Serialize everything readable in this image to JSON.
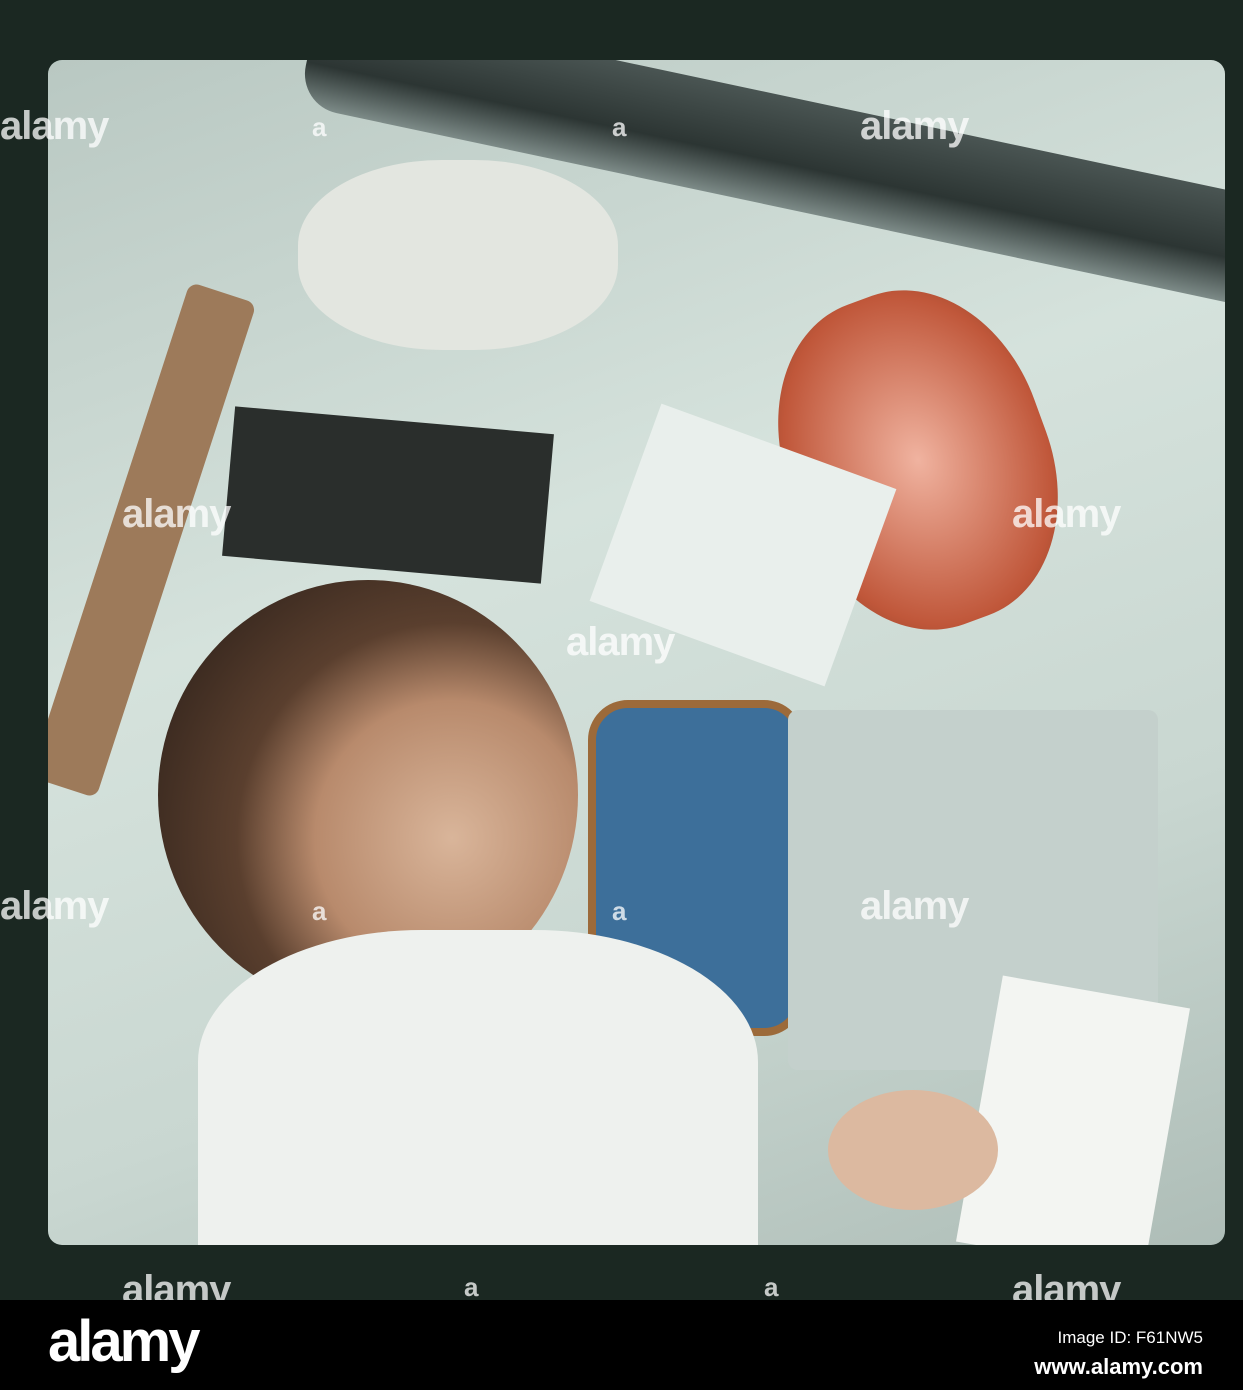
{
  "watermark": {
    "text": "alamy",
    "dot": "a"
  },
  "footer": {
    "logo": "alamy",
    "image_id": "Image ID: F61NW5",
    "website": "www.alamy.com"
  },
  "colors": {
    "frame": "#1b2822",
    "cabin": "#d5e2dc",
    "window": "#3d6f9a",
    "hatch": "#c0573a"
  }
}
